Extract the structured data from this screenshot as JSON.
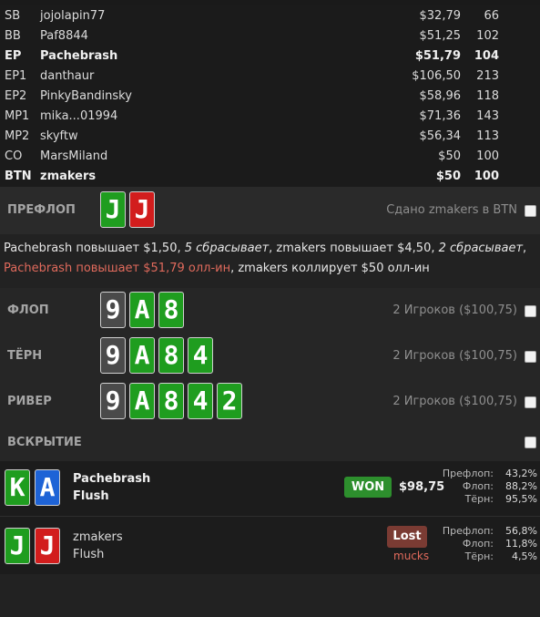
{
  "seats": [
    {
      "pos": "SB",
      "name": "jojolapin77",
      "amount": "$32,79",
      "bb": "66",
      "bold": false
    },
    {
      "pos": "BB",
      "name": "Paf8844",
      "amount": "$51,25",
      "bb": "102",
      "bold": false
    },
    {
      "pos": "EP",
      "name": "Pachebrash",
      "amount": "$51,79",
      "bb": "104",
      "bold": true
    },
    {
      "pos": "EP1",
      "name": "danthaur",
      "amount": "$106,50",
      "bb": "213",
      "bold": false
    },
    {
      "pos": "EP2",
      "name": "PinkyBandinsky",
      "amount": "$58,96",
      "bb": "118",
      "bold": false
    },
    {
      "pos": "MP1",
      "name": "mika...01994",
      "amount": "$71,36",
      "bb": "143",
      "bold": false
    },
    {
      "pos": "MP2",
      "name": "skyftw",
      "amount": "$56,34",
      "bb": "113",
      "bold": false
    },
    {
      "pos": "CO",
      "name": "MarsMiland",
      "amount": "$50",
      "bb": "100",
      "bold": false
    },
    {
      "pos": "BTN",
      "name": "zmakers",
      "amount": "$50",
      "bb": "100",
      "bold": true
    }
  ],
  "preflop": {
    "label": "ПРЕФЛОП",
    "dealt": "Сдано zmakers в BTN",
    "cards": [
      {
        "rank": "J",
        "color": "green"
      },
      {
        "rank": "J",
        "color": "red"
      }
    ]
  },
  "actions": {
    "a1": "Pachebrash повышает $1,50, ",
    "a2": "5 сбрасывает",
    "a3": ", zmakers повышает $4,50, ",
    "a4": "2 сбрасывает",
    "a5": ",",
    "a6": "Pachebrash повышает $51,79 олл-ин",
    "a7": ", zmakers коллирует $50 олл-ин"
  },
  "streets": [
    {
      "label": "ФЛОП",
      "info": "2 Игроков ($100,75)",
      "cards": [
        "9",
        "A",
        "8"
      ]
    },
    {
      "label": "ТЁРН",
      "info": "2 Игроков ($100,75)",
      "cards": [
        "9",
        "A",
        "8",
        "4"
      ]
    },
    {
      "label": "РИВЕР",
      "info": "2 Игроков ($100,75)",
      "cards": [
        "9",
        "A",
        "8",
        "4",
        "2"
      ]
    }
  ],
  "showdown": {
    "label": "ВСКРЫТИЕ",
    "players": [
      {
        "cards": [
          {
            "rank": "K",
            "color": "green"
          },
          {
            "rank": "A",
            "color": "blue"
          }
        ],
        "name": "Pachebrash",
        "hand": "Flush",
        "bold": true,
        "result": "WON",
        "amount": "$98,75",
        "eq": [
          {
            "l": "Префлоп:",
            "v": "43,2%"
          },
          {
            "l": "Флоп:",
            "v": "88,2%"
          },
          {
            "l": "Тёрн:",
            "v": "95,5%"
          }
        ]
      },
      {
        "cards": [
          {
            "rank": "J",
            "color": "green"
          },
          {
            "rank": "J",
            "color": "red"
          }
        ],
        "name": "zmakers",
        "hand": "Flush",
        "bold": false,
        "result": "Lost",
        "note": "mucks",
        "eq": [
          {
            "l": "Префлоп:",
            "v": "56,8%"
          },
          {
            "l": "Флоп:",
            "v": "11,8%"
          },
          {
            "l": "Тёрн:",
            "v": "4,5%"
          }
        ]
      }
    ]
  },
  "colors": {
    "green": "#1f9d1f",
    "red": "#d21d1d",
    "blue": "#1e63d6",
    "gray": "#4a4a4a",
    "won": "#2d8f2d",
    "lost": "#7a3b33"
  }
}
